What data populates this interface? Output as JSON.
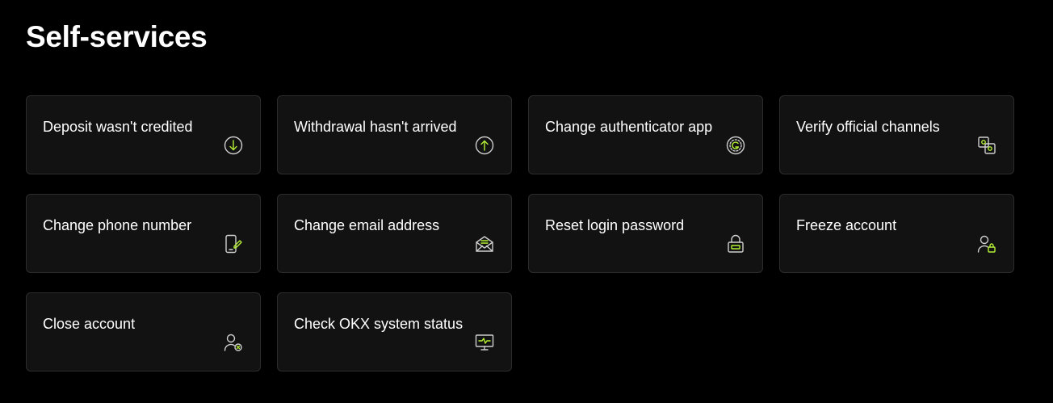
{
  "page": {
    "title": "Self-services"
  },
  "colors": {
    "background": "#000000",
    "card_background": "#121212",
    "card_border": "#2c2c2c",
    "icon_stroke": "#cfcfcf",
    "icon_accent": "#b5f035"
  },
  "cards": [
    {
      "label": "Deposit wasn't credited",
      "icon": "download-icon"
    },
    {
      "label": "Withdrawal hasn't arrived",
      "icon": "upload-icon"
    },
    {
      "label": "Change authenticator app",
      "icon": "authenticator-icon"
    },
    {
      "label": "Verify official channels",
      "icon": "verify-channels-icon"
    },
    {
      "label": "Change phone number",
      "icon": "phone-edit-icon"
    },
    {
      "label": "Change email address",
      "icon": "envelope-icon"
    },
    {
      "label": "Reset login password",
      "icon": "lock-reset-icon"
    },
    {
      "label": "Freeze account",
      "icon": "user-lock-icon"
    },
    {
      "label": "Close account",
      "icon": "user-remove-icon"
    },
    {
      "label": "Check OKX system status",
      "icon": "monitor-status-icon"
    }
  ]
}
